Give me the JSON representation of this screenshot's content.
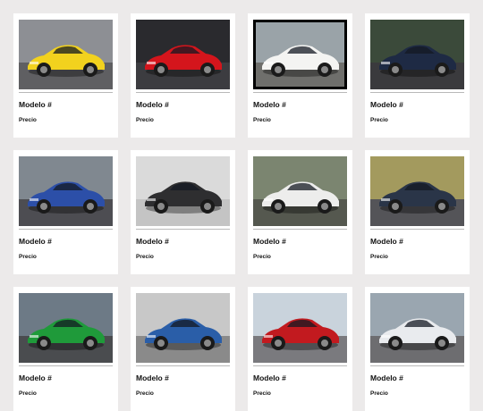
{
  "products": [
    {
      "model_label": "Modelo #",
      "price_label": "Precio",
      "car_color": "#f2d21e",
      "bg_color": "#8d8f94",
      "ground_color": "#5f5f62",
      "icon": "car-photo-yellow-corvette"
    },
    {
      "model_label": "Modelo #",
      "price_label": "Precio",
      "car_color": "#d4151c",
      "bg_color": "#2a2a2e",
      "ground_color": "#3c3c40",
      "icon": "car-photo-red-ferrari"
    },
    {
      "model_label": "Modelo #",
      "price_label": "Precio",
      "car_color": "#f4f4f2",
      "bg_color": "#9aa3a8",
      "ground_color": "#6f6f6c",
      "icon": "car-photo-white-supercar"
    },
    {
      "model_label": "Modelo #",
      "price_label": "Precio",
      "car_color": "#1e2a44",
      "bg_color": "#3b4a3a",
      "ground_color": "#3a3a3d",
      "icon": "car-photo-dark-bugatti"
    },
    {
      "model_label": "Modelo #",
      "price_label": "Precio",
      "car_color": "#2c4fa8",
      "bg_color": "#808890",
      "ground_color": "#4d4d52",
      "icon": "car-photo-blue-hypercar"
    },
    {
      "model_label": "Modelo #",
      "price_label": "Precio",
      "car_color": "#2e2e30",
      "bg_color": "#dadada",
      "ground_color": "#c4c4c4",
      "icon": "car-photo-black-mclaren"
    },
    {
      "model_label": "Modelo #",
      "price_label": "Precio",
      "car_color": "#ededec",
      "bg_color": "#7b8570",
      "ground_color": "#55584f",
      "icon": "car-photo-white-pagani"
    },
    {
      "model_label": "Modelo #",
      "price_label": "Precio",
      "car_color": "#2a3548",
      "bg_color": "#a39a5e",
      "ground_color": "#545458",
      "icon": "car-photo-dark-mclaren"
    },
    {
      "model_label": "Modelo #",
      "price_label": "Precio",
      "car_color": "#1f9a3a",
      "bg_color": "#6d7a86",
      "ground_color": "#4a4c4f",
      "icon": "car-photo-green-amg"
    },
    {
      "model_label": "Modelo #",
      "price_label": "Precio",
      "car_color": "#2a5ea8",
      "bg_color": "#c8c8c8",
      "ground_color": "#8a8a8a",
      "icon": "car-photo-blue-mustang"
    },
    {
      "model_label": "Modelo #",
      "price_label": "Precio",
      "car_color": "#c21a1f",
      "bg_color": "#c9d3dc",
      "ground_color": "#7a7a7e",
      "icon": "car-photo-red-koenigsegg"
    },
    {
      "model_label": "Modelo #",
      "price_label": "Precio",
      "car_color": "#e9ebee",
      "bg_color": "#9aa6b0",
      "ground_color": "#6d6d70",
      "icon": "car-photo-white-camaro"
    }
  ]
}
